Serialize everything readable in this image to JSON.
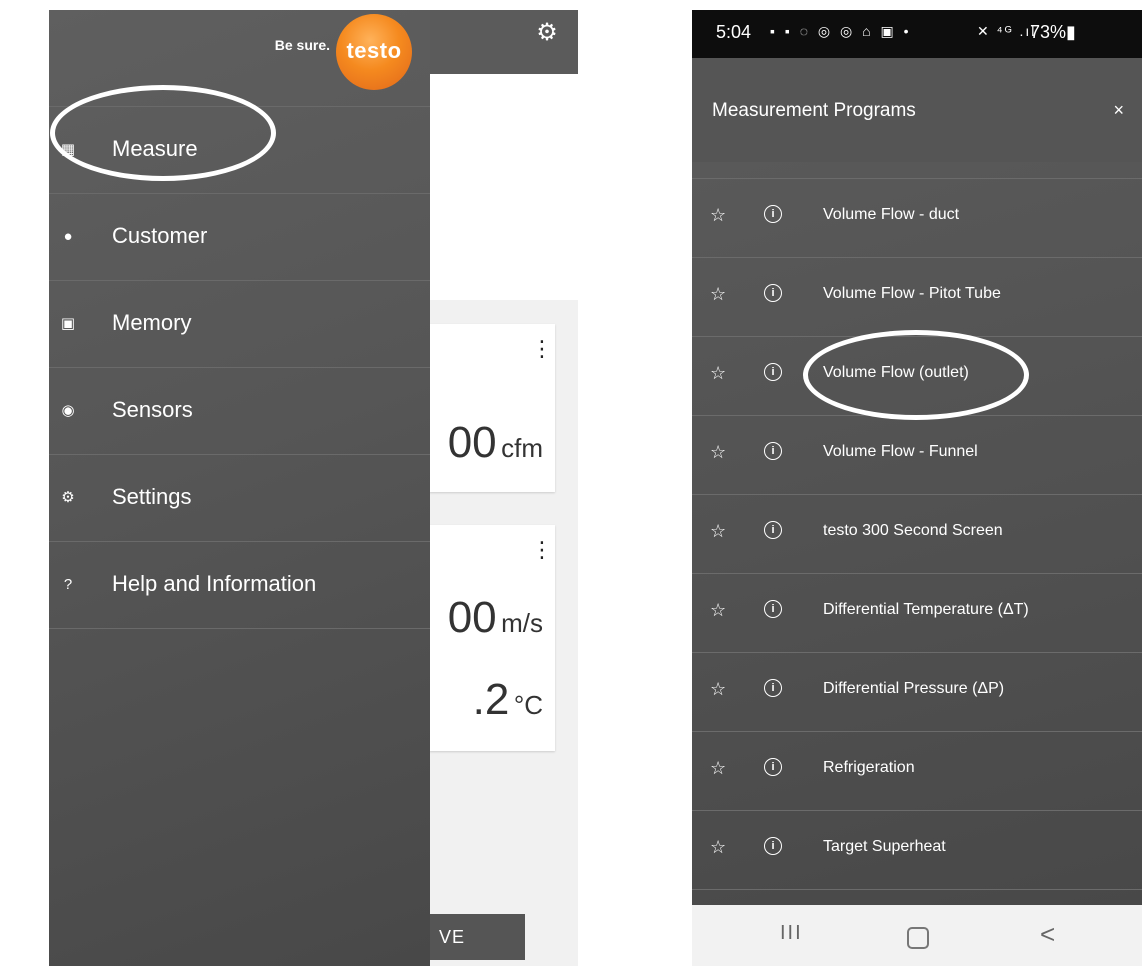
{
  "left": {
    "brand_tagline": "Be sure.",
    "brand_logo": "testo",
    "menu": [
      {
        "label": "Measure",
        "icon": "grid-icon"
      },
      {
        "label": "Customer",
        "icon": "person-icon"
      },
      {
        "label": "Memory",
        "icon": "save-icon"
      },
      {
        "label": "Sensors",
        "icon": "sensor-icon"
      },
      {
        "label": "Settings",
        "icon": "gear-icon"
      },
      {
        "label": "Help and Information",
        "icon": "help-icon"
      }
    ],
    "cards": [
      {
        "value": "00",
        "unit": "cfm"
      },
      {
        "value": "00",
        "unit": "m/s"
      },
      {
        "value": ".2",
        "unit": "°C"
      }
    ],
    "save_label": "VE"
  },
  "right": {
    "status": {
      "time": "5:04",
      "icons": "▪ ▪ ◌ ◎ ◎ ⌂ ▣ •",
      "signal": "✕ ⁴ᴳ .ıl",
      "battery": "73%▮"
    },
    "header_title": "Measurement Programs",
    "close_label": "×",
    "programs": [
      "Volume Flow - duct",
      "Volume Flow - Pitot Tube",
      "Volume Flow (outlet)",
      "Volume Flow - Funnel",
      "testo 300 Second Screen",
      "Differential Temperature (ΔT)",
      "Differential Pressure (ΔP)",
      "Refrigeration",
      "Target Superheat"
    ],
    "nav": {
      "recent": "III",
      "back": "<"
    }
  },
  "colors": {
    "drawer_bg": "#565656",
    "brand_orange": "#f58a1f",
    "status_bar": "#0d0d0d",
    "nav_bar": "#f2f2f2"
  }
}
